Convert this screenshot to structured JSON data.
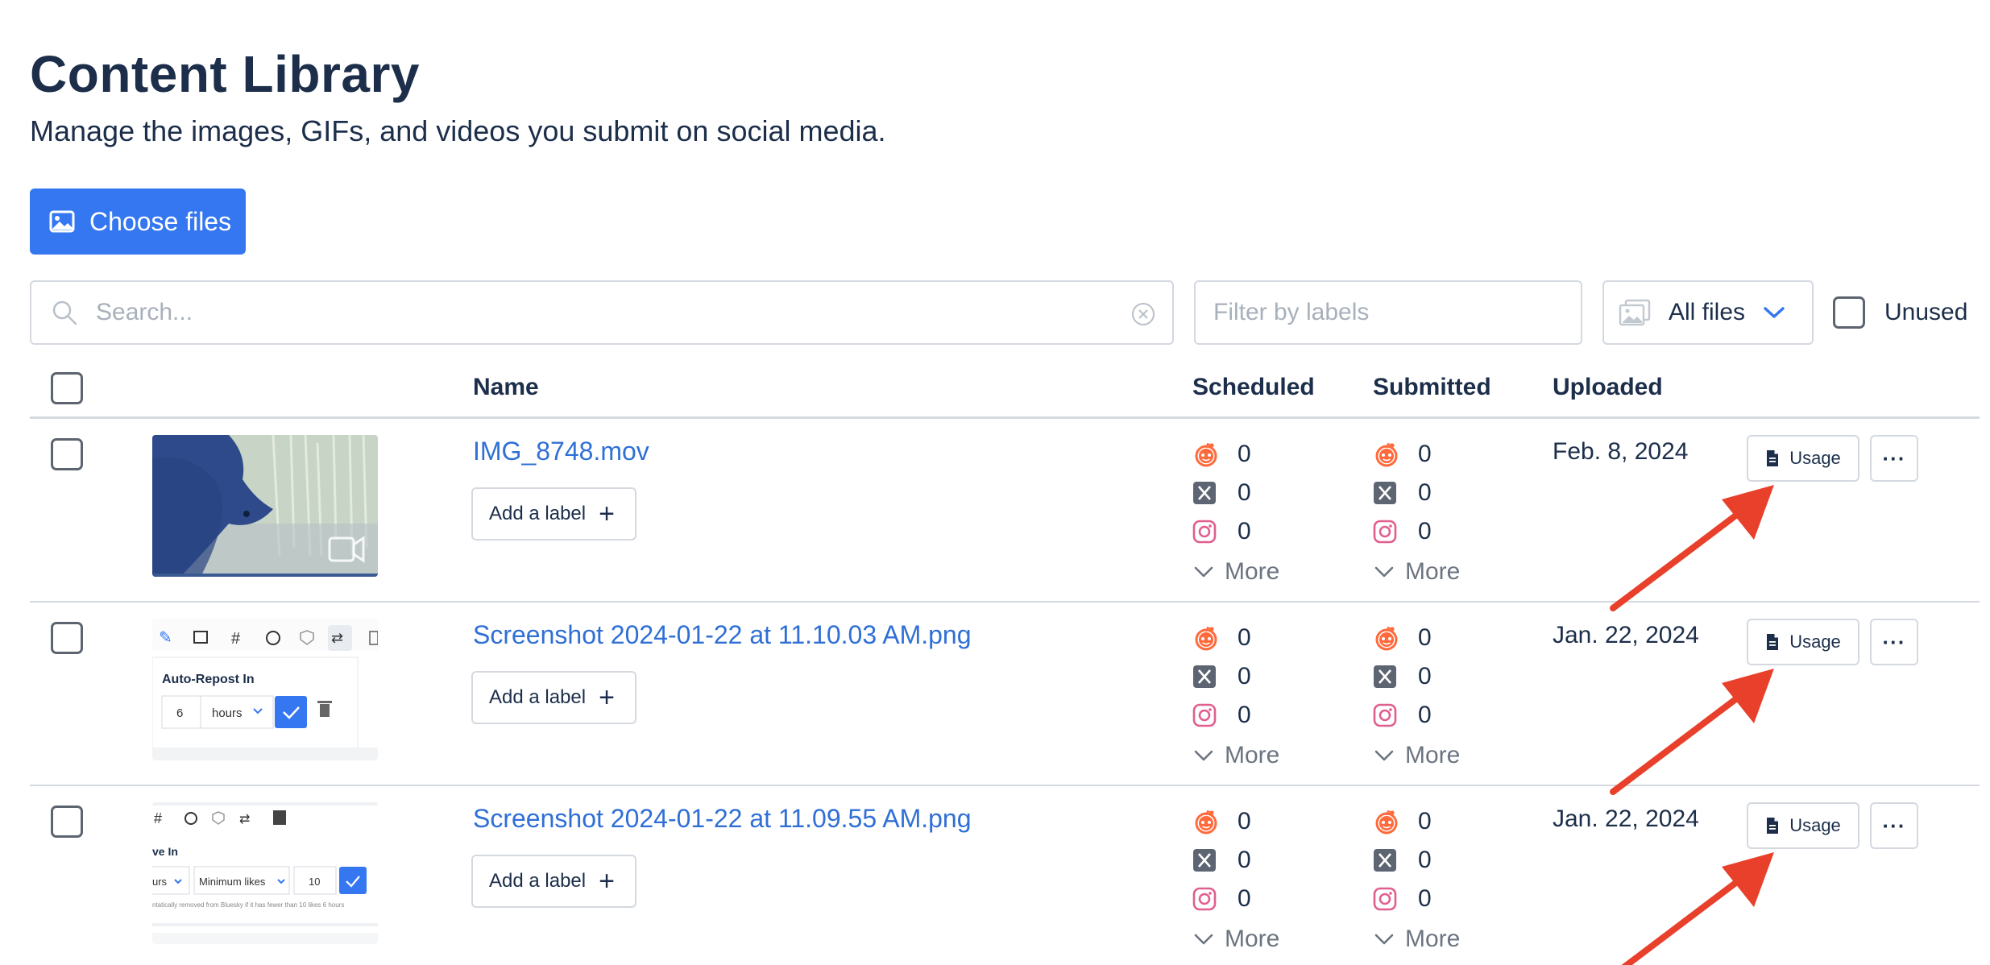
{
  "header": {
    "title": "Content Library",
    "subtitle": "Manage the images, GIFs, and videos you submit on social media."
  },
  "toolbar": {
    "choose_files_label": "Choose files",
    "search_placeholder": "Search...",
    "filter_placeholder": "Filter by labels",
    "file_type_selected": "All files",
    "unused_label": "Unused"
  },
  "table": {
    "columns": [
      "Name",
      "Scheduled",
      "Submitted",
      "Uploaded"
    ],
    "rows": [
      {
        "name": "IMG_8748.mov",
        "add_label": "Add a label",
        "scheduled": {
          "reddit": "0",
          "x": "0",
          "instagram": "0",
          "more": "More"
        },
        "submitted": {
          "reddit": "0",
          "x": "0",
          "instagram": "0",
          "more": "More"
        },
        "uploaded": "Feb. 8, 2024",
        "usage_label": "Usage",
        "thumbnail": "video-thumbnail"
      },
      {
        "name": "Screenshot 2024-01-22 at 11.10.03 AM.png",
        "add_label": "Add a label",
        "scheduled": {
          "reddit": "0",
          "x": "0",
          "instagram": "0",
          "more": "More"
        },
        "submitted": {
          "reddit": "0",
          "x": "0",
          "instagram": "0",
          "more": "More"
        },
        "uploaded": "Jan. 22, 2024",
        "usage_label": "Usage",
        "thumbnail": "screenshot-thumbnail",
        "thumb_text": {
          "title": "Auto-Repost In",
          "value": "6",
          "unit": "hours"
        }
      },
      {
        "name": "Screenshot 2024-01-22 at 11.09.55 AM.png",
        "add_label": "Add a label",
        "scheduled": {
          "reddit": "0",
          "x": "0",
          "instagram": "0",
          "more": "More"
        },
        "submitted": {
          "reddit": "0",
          "x": "0",
          "instagram": "0",
          "more": "More"
        },
        "uploaded": "Jan. 22, 2024",
        "usage_label": "Usage",
        "thumbnail": "screenshot-thumbnail",
        "thumb_text": {
          "title": "ve In",
          "unit": "urs",
          "select": "Minimum likes",
          "value": "10",
          "note": "ntatically removed from Bluesky if it has fewer than 10 likes 6 hours"
        }
      }
    ]
  },
  "colors": {
    "accent": "#3577f1",
    "link": "#2f6fd6",
    "reddit": "#ff6a3d",
    "x_icon": "#5d6572",
    "instagram": "#e05f8e",
    "annotation_arrow": "#e8402a"
  },
  "icons": [
    "image-icon",
    "search-icon",
    "clear-icon",
    "gallery-icon",
    "chevron-down-icon",
    "plus-icon",
    "reddit-icon",
    "x-icon",
    "instagram-icon",
    "document-icon",
    "more-dots-icon",
    "arrow-annotation"
  ]
}
